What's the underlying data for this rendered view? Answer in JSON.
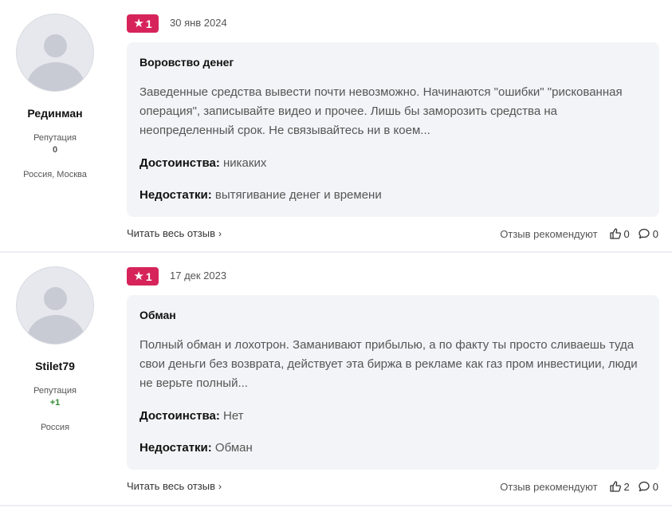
{
  "reviews": [
    {
      "author": "Рединман",
      "reputation_label": "Репутация",
      "reputation_value": "0",
      "location": "Россия, Москва",
      "rating": "1",
      "date": "30 янв 2024",
      "title": "Воровство денег",
      "text": "Заведенные средства вывести почти невозможно. Начинаются \"ошибки\" \"рискованная операция\", записывайте видео и прочее. Лишь бы заморозить средства на неопределенный срок. Не связывайтесь ни в коем...",
      "pros_label": "Достоинства:",
      "pros": " никаких",
      "cons_label": "Недостатки:",
      "cons": " вытягивание денег и времени",
      "read_more": "Читать весь отзыв",
      "recommend_label": "Отзыв рекомендуют",
      "likes": "0",
      "comments": "0"
    },
    {
      "author": "Stilet79",
      "reputation_label": "Репутация",
      "reputation_value": "+1",
      "location": "Россия",
      "rating": "1",
      "date": "17 дек 2023",
      "title": "Обман",
      "text": "Полный обман и лохотрон. Заманивают прибылью, а по факту ты просто сливаешь туда свои деньги без возврата, действует эта биржа в рекламе как газ пром инвестиции, люди не верьте полный...",
      "pros_label": "Достоинства:",
      "pros": " Нет",
      "cons_label": "Недостатки:",
      "cons": " Обман",
      "read_more": "Читать весь отзыв",
      "recommend_label": "Отзыв рекомендуют",
      "likes": "2",
      "comments": "0"
    }
  ],
  "colors": {
    "rating_badge": "#d6245a",
    "card_bg": "#f3f4f7",
    "positive": "#2e8b2e"
  },
  "icons": {
    "star": "star-icon",
    "like": "thumbs-up-icon",
    "comment": "comment-icon",
    "chevron": "chevron-right-icon"
  }
}
